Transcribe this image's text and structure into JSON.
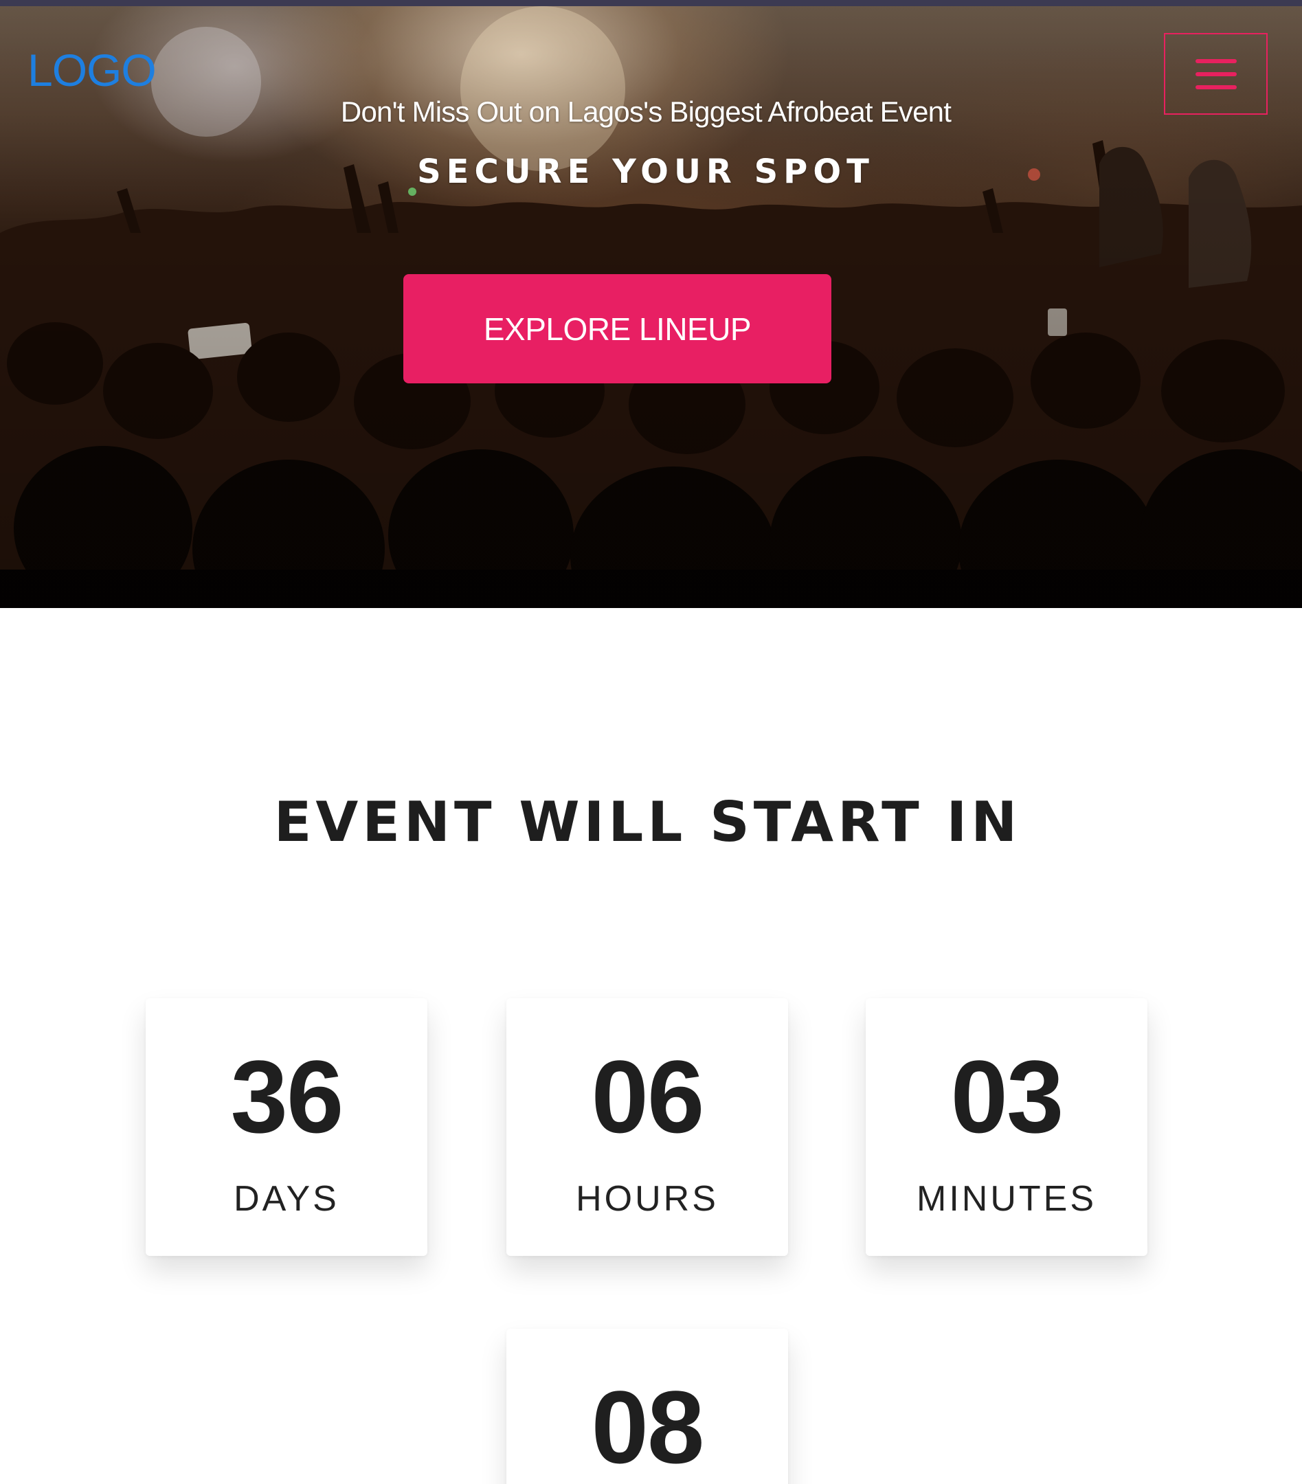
{
  "header": {
    "logo_text": "LOGO",
    "menu_icon": "hamburger-menu-icon"
  },
  "hero": {
    "subtitle": "Don't Miss Out on Lagos's Biggest Afrobeat Event",
    "title": "SECURE YOUR SPOT",
    "cta_label": "EXPLORE LINEUP"
  },
  "countdown": {
    "title": "EVENT WILL START IN",
    "days": {
      "value": "36",
      "label": "DAYS"
    },
    "hours": {
      "value": "06",
      "label": "HOURS"
    },
    "minutes": {
      "value": "03",
      "label": "MINUTES"
    },
    "seconds": {
      "value": "08"
    }
  },
  "colors": {
    "accent": "#e81f63",
    "logo": "#1e7fe0",
    "text_dark": "#1f1f1f"
  }
}
